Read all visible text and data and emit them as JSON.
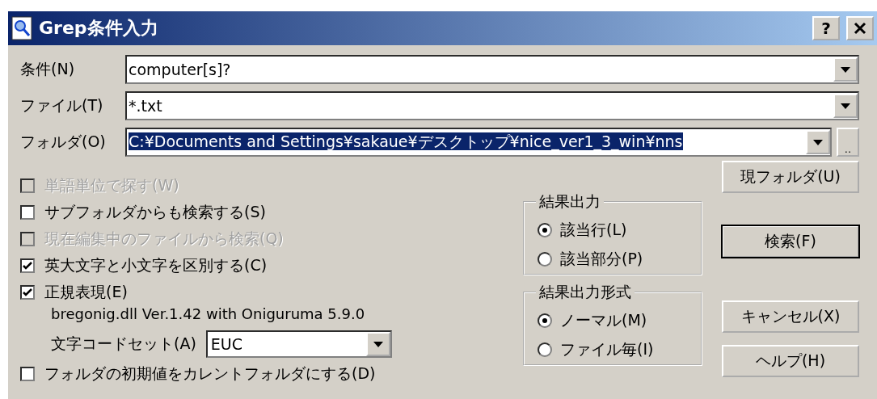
{
  "window": {
    "title": "Grep条件入力",
    "help_button": "?"
  },
  "fields": [
    {
      "label": "条件(N)",
      "value": "computer[s]?",
      "highlighted": false
    },
    {
      "label": "ファイル(T)",
      "value": "*.txt",
      "highlighted": false
    },
    {
      "label": "フォルダ(O)",
      "value": "C:¥Documents and Settings¥sakaue¥デスクトップ¥nice_ver1_3_win¥nns",
      "highlighted": true,
      "browse_button": ".."
    }
  ],
  "options": [
    {
      "kind": "checkbox",
      "label": "単語単位で探す(W)",
      "checked": false,
      "disabled": true
    },
    {
      "kind": "checkbox",
      "label": "サブフォルダからも検索する(S)",
      "checked": false,
      "disabled": false
    },
    {
      "kind": "checkbox",
      "label": "現在編集中のファイルから検索(Q)",
      "checked": false,
      "disabled": true
    },
    {
      "kind": "checkbox",
      "label": "英大文字と小文字を区別する(C)",
      "checked": true,
      "disabled": false
    },
    {
      "kind": "checkbox",
      "label": "正規表現(E)",
      "checked": true,
      "disabled": false
    },
    {
      "kind": "note",
      "label": "bregonig.dll Ver.1.42 with Oniguruma 5.9.0"
    },
    {
      "kind": "select",
      "label": "文字コードセット(A)",
      "value": "EUC"
    },
    {
      "kind": "checkbox",
      "label": "フォルダの初期値をカレントフォルダにする(D)",
      "checked": false,
      "disabled": false
    }
  ],
  "groups": [
    {
      "title": "結果出力",
      "options": [
        {
          "label": "該当行(L)",
          "selected": true
        },
        {
          "label": "該当部分(P)",
          "selected": false
        }
      ]
    },
    {
      "title": "結果出力形式",
      "options": [
        {
          "label": "ノーマル(M)",
          "selected": true
        },
        {
          "label": "ファイル毎(I)",
          "selected": false
        }
      ]
    }
  ],
  "current_folder_button": "現フォルダ(U)",
  "buttons": [
    {
      "label": "検索(F)",
      "default": true
    },
    {
      "label": "キャンセル(X)",
      "default": false
    },
    {
      "label": "ヘルプ(H)",
      "default": false
    }
  ]
}
